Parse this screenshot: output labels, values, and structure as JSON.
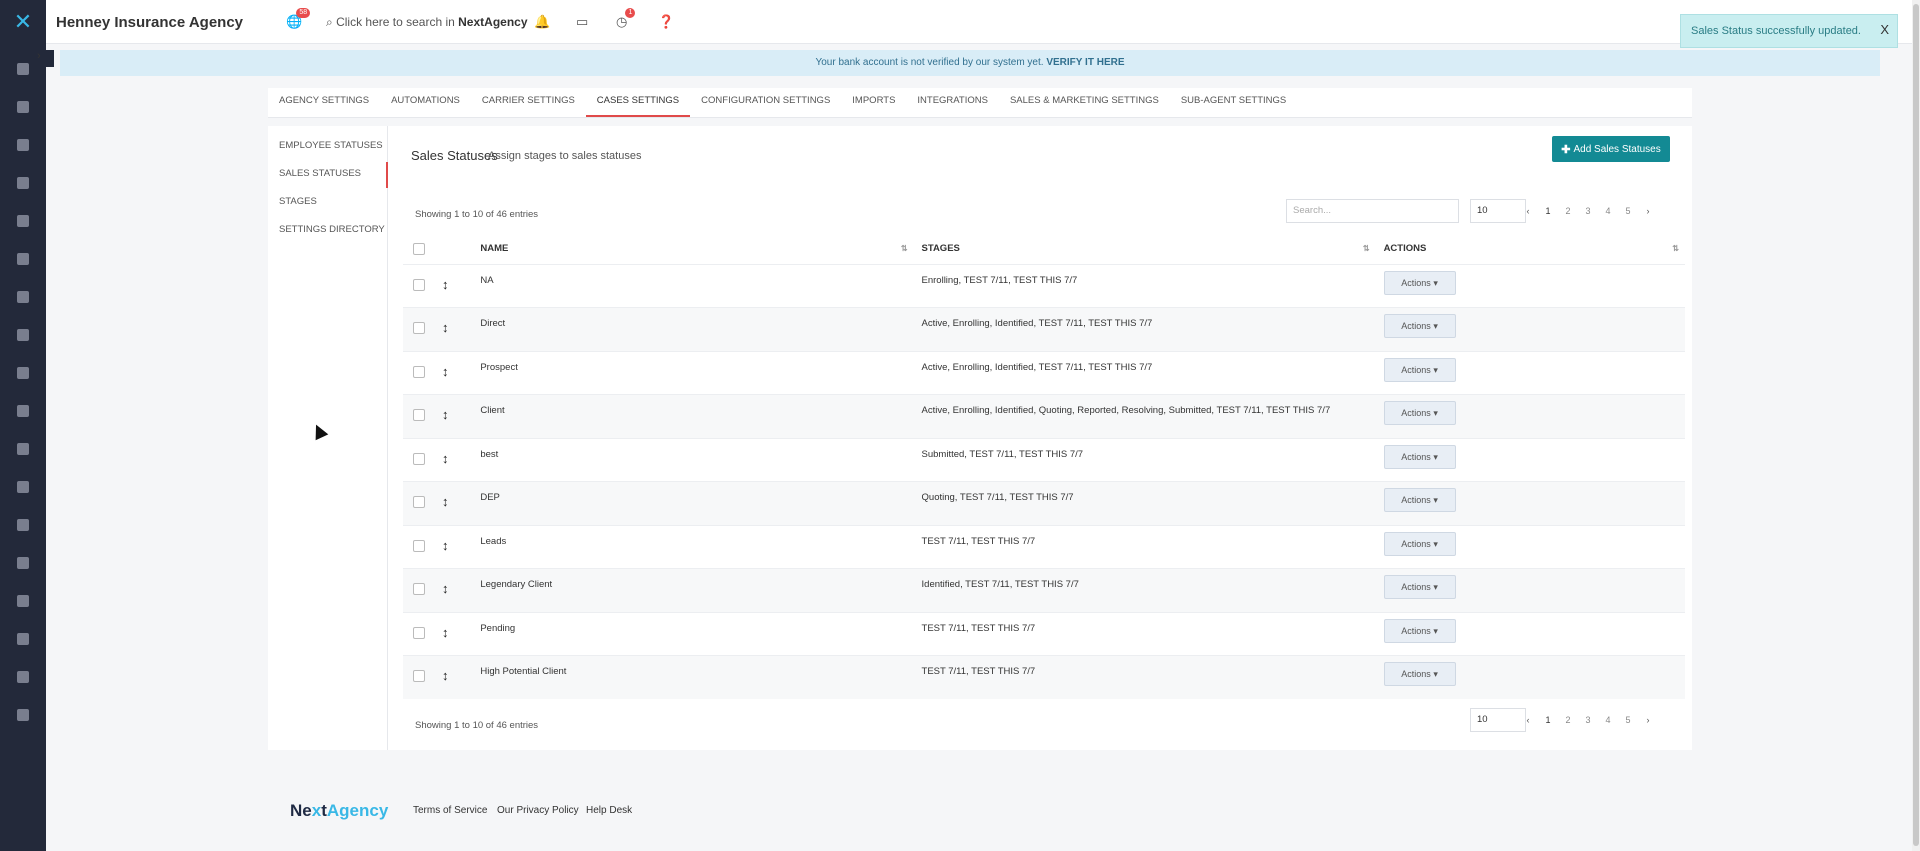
{
  "header": {
    "brand": "Henney Insurance Agency",
    "globe_badge": "58",
    "search_prefix": "Click here to search in",
    "search_brand": "NextAgency",
    "clock_badge": "1"
  },
  "toast": {
    "message": "Sales Status successfully updated.",
    "close": "X"
  },
  "banner": {
    "text": "Your bank account is not verified by our system yet.",
    "link": "VERIFY IT HERE"
  },
  "tabs": [
    {
      "label": "Agency Settings"
    },
    {
      "label": "Automations"
    },
    {
      "label": "Carrier Settings"
    },
    {
      "label": "Cases Settings"
    },
    {
      "label": "Configuration Settings"
    },
    {
      "label": "Imports"
    },
    {
      "label": "Integrations"
    },
    {
      "label": "Sales & Marketing Settings"
    },
    {
      "label": "Sub-Agent Settings"
    }
  ],
  "subnav": [
    {
      "label": "Employee Statuses"
    },
    {
      "label": "Sales Statuses"
    },
    {
      "label": "Stages"
    },
    {
      "label": "Settings Directory"
    }
  ],
  "content": {
    "title": "Sales Statuses",
    "subtitle": "Assign stages to sales statuses",
    "add_button": "Add Sales Statuses",
    "showing": "Showing 1 to 10 of 46 entries",
    "search_placeholder": "Search...",
    "page_length": "10",
    "pages": [
      "1",
      "2",
      "3",
      "4",
      "5"
    ]
  },
  "table": {
    "columns": {
      "name": "NAME",
      "stages": "STAGES",
      "actions": "ACTIONS"
    },
    "action_label": "Actions",
    "rows": [
      {
        "name": "NA",
        "stages": "Enrolling, TEST 7/11, TEST THIS 7/7"
      },
      {
        "name": "Direct",
        "stages": "Active, Enrolling, Identified, TEST 7/11, TEST THIS 7/7"
      },
      {
        "name": "Prospect",
        "stages": "Active, Enrolling, Identified, TEST 7/11, TEST THIS 7/7"
      },
      {
        "name": "Client",
        "stages": "Active, Enrolling, Identified, Quoting, Reported, Resolving, Submitted, TEST 7/11, TEST THIS 7/7"
      },
      {
        "name": "best",
        "stages": "Submitted, TEST 7/11, TEST THIS 7/7"
      },
      {
        "name": "DEP",
        "stages": "Quoting, TEST 7/11, TEST THIS 7/7"
      },
      {
        "name": "Leads",
        "stages": "TEST 7/11, TEST THIS 7/7"
      },
      {
        "name": "Legendary Client",
        "stages": "Identified, TEST 7/11, TEST THIS 7/7"
      },
      {
        "name": "Pending",
        "stages": "TEST 7/11, TEST THIS 7/7"
      },
      {
        "name": "High Potential Client",
        "stages": "TEST 7/11, TEST THIS 7/7"
      }
    ]
  },
  "footer": {
    "logo_part1": "Ne",
    "logo_x": "x",
    "logo_part2": "t",
    "logo_part3": "Agency",
    "links": [
      "Terms of Service",
      "Our Privacy Policy",
      "Help Desk"
    ]
  }
}
